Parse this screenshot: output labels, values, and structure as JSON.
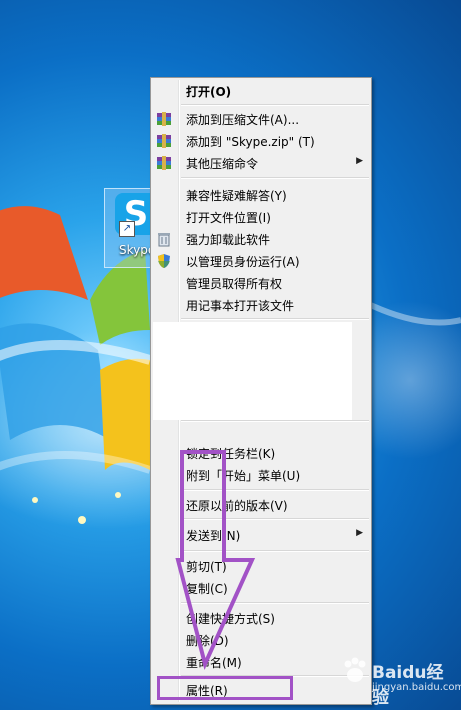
{
  "desktop": {
    "icon_label": "Skype",
    "icon_letter": "S"
  },
  "menu": {
    "items": [
      {
        "label": "打开(O)"
      },
      {
        "label": "添加到压缩文件(A)...",
        "icon": "winrar-archive-icon"
      },
      {
        "label": "添加到 \"Skype.zip\" (T)",
        "icon": "winrar-archive-icon"
      },
      {
        "label": "其他压缩命令",
        "icon": "winrar-archive-icon",
        "submenu": "▶"
      },
      {
        "label": "兼容性疑难解答(Y)"
      },
      {
        "label": "打开文件位置(I)"
      },
      {
        "label": "强力卸载此软件",
        "icon": "trash-bin-icon"
      },
      {
        "label": "以管理员身份运行(A)",
        "icon": "uac-shield-icon"
      },
      {
        "label": "管理员取得所有权"
      },
      {
        "label": "用记事本打开该文件"
      },
      {
        "label": "锁定到任务栏(K)"
      },
      {
        "label": "附到「开始」菜单(U)"
      },
      {
        "label": "还原以前的版本(V)"
      },
      {
        "label": "发送到(N)",
        "submenu": "▶"
      },
      {
        "label": "剪切(T)"
      },
      {
        "label": "复制(C)"
      },
      {
        "label": "创建快捷方式(S)"
      },
      {
        "label": "删除(D)"
      },
      {
        "label": "重命名(M)"
      },
      {
        "label": "属性(R)"
      }
    ]
  },
  "watermark": {
    "title": "Baidu经验",
    "url": "jingyan.baidu.com"
  },
  "colors": {
    "annotation": "#a252c6",
    "menu_bg": "#f0f0f0"
  }
}
